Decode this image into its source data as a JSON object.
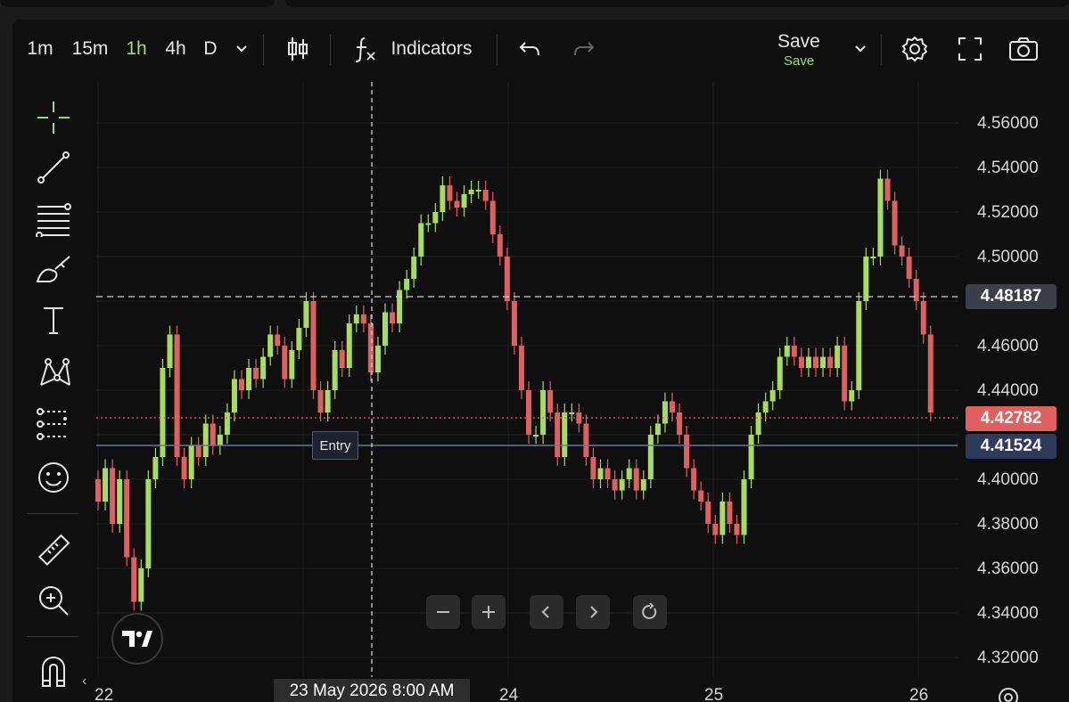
{
  "toolbar": {
    "intervals": [
      "1m",
      "15m",
      "1h",
      "4h",
      "D"
    ],
    "active_interval": "1h",
    "indicators_label": "Indicators",
    "save_label": "Save",
    "save_status": "Save"
  },
  "price_scale": {
    "labels": [
      "4.56000",
      "4.54000",
      "4.52000",
      "4.50000",
      "4.46000",
      "4.44000",
      "4.40000",
      "4.38000",
      "4.36000",
      "4.34000",
      "4.32000"
    ],
    "reference_price": "4.48187",
    "last_price": "4.42782",
    "entry_price": "4.41524"
  },
  "time_scale": {
    "labels": [
      "22",
      "24",
      "25",
      "26"
    ],
    "crosshair_label": "23 May 2026   8:00 AM"
  },
  "entry_label": "Entry",
  "colors": {
    "up": "#a9dc5a",
    "down": "#e06060",
    "background": "#0f0f0f",
    "last_price_tag": "#e06060",
    "entry_tag": "#2e3a5a",
    "reference_tag": "#3a3f4a"
  },
  "left_tools": [
    "crosshair-icon",
    "trendline-icon",
    "fib-icon",
    "brush-icon",
    "text-icon",
    "pattern-icon",
    "prediction-icon",
    "emoji-icon",
    "ruler-icon",
    "zoom-in-icon",
    "magnet-icon"
  ],
  "nav_buttons": [
    "zoom-out-icon",
    "zoom-plus-icon",
    "scroll-left-icon",
    "scroll-right-icon",
    "reset-icon"
  ]
}
